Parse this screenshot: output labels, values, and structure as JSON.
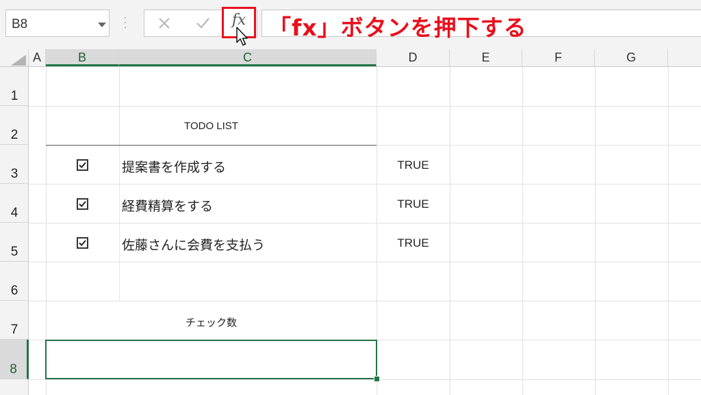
{
  "formula_bar": {
    "name_box_value": "B8",
    "fx_label": "fx",
    "formula_value": ""
  },
  "annotation": {
    "text": "「fx」ボタンを押下する",
    "color": "#e8101c"
  },
  "columns": [
    "A",
    "B",
    "C",
    "D",
    "E",
    "F",
    "G"
  ],
  "rows": [
    "1",
    "2",
    "3",
    "4",
    "5",
    "6",
    "7",
    "8"
  ],
  "sheet": {
    "title": "TODO LIST",
    "tasks": [
      {
        "label": "提案書を作成する",
        "checked": true,
        "value": "TRUE"
      },
      {
        "label": "経費精算をする",
        "checked": true,
        "value": "TRUE"
      },
      {
        "label": "佐藤さんに会費を支払う",
        "checked": true,
        "value": "TRUE"
      }
    ],
    "count_label": "チェック数",
    "count_value": ""
  },
  "colors": {
    "accent_green": "#217346",
    "highlight_red": "#e8101c"
  }
}
